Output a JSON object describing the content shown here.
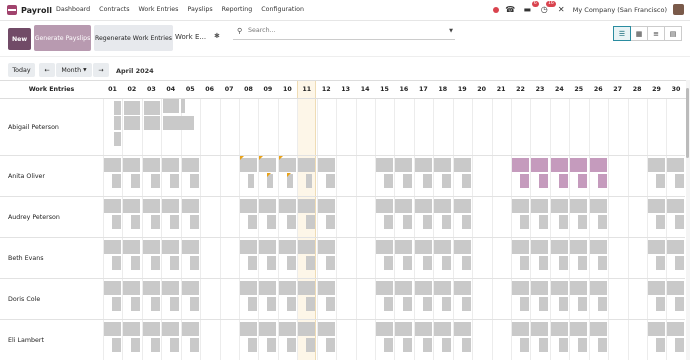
{
  "nav": {
    "app_name": "Payroll",
    "menu": [
      "Dashboard",
      "Contracts",
      "Work Entries",
      "Payslips",
      "Reporting",
      "Configuration"
    ],
    "chat_badge": "6",
    "activity_badge": "16",
    "company": "My Company (San Francisco)"
  },
  "control": {
    "new_label": "New",
    "generate_label": "Generate Payslips",
    "regenerate_label": "Regenerate Work Entries",
    "breadcrumb": "Work E...",
    "search_placeholder": "Search..."
  },
  "gantt": {
    "today_label": "Today",
    "prev_label": "←",
    "scale_label": "Month",
    "next_label": "→",
    "period_title": "April 2024",
    "row_header": "Work Entries",
    "days": [
      "01",
      "02",
      "03",
      "04",
      "05",
      "06",
      "07",
      "08",
      "09",
      "10",
      "11",
      "12",
      "13",
      "14",
      "15",
      "16",
      "17",
      "18",
      "19",
      "20",
      "21",
      "22",
      "23",
      "24",
      "25",
      "26",
      "27",
      "28",
      "29",
      "30"
    ],
    "today": "11",
    "employees": [
      "Abigail Peterson",
      "Anita Oliver",
      "Audrey Peterson",
      "Beth Evans",
      "Doris Cole",
      "Eli Lambert"
    ]
  },
  "colors": {
    "brand": "#714b67",
    "attendance": "#c9c9c9",
    "time_off": "#c59bbd",
    "warning": "#e8a21a",
    "today_highlight": "#fcefd6"
  }
}
